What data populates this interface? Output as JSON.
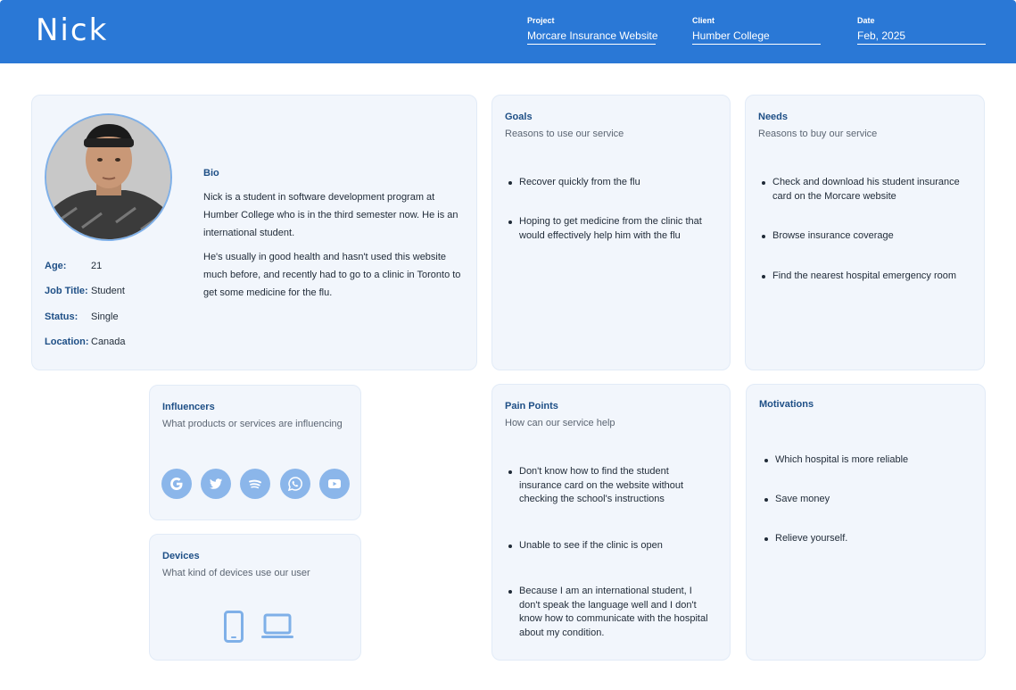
{
  "header": {
    "name": "Nick",
    "project": {
      "label": "Project",
      "value": "Morcare Insurance Website"
    },
    "client": {
      "label": "Client",
      "value": "Humber College"
    },
    "date": {
      "label": "Date",
      "value": "Feb, 2025"
    }
  },
  "profile": {
    "stats": [
      {
        "label": "Age:",
        "value": "21"
      },
      {
        "label": "Job Title:",
        "value": "Student"
      },
      {
        "label": "Status:",
        "value": "Single"
      },
      {
        "label": "Location:",
        "value": "Canada"
      }
    ],
    "bio_label": "Bio",
    "bio": [
      "Nick is a student in software development program at Humber College who is in the third semester now. He is an international student.",
      "He's usually in good health and hasn't used this website much before, and recently had to go to a clinic in Toronto to get some medicine for the flu."
    ]
  },
  "goals": {
    "title": "Goals",
    "subtitle": "Reasons to use our service",
    "items": [
      "Recover quickly from the flu",
      "Hoping to get medicine from the clinic that would effectively help him with the flu"
    ]
  },
  "needs": {
    "title": "Needs",
    "subtitle": "Reasons to buy our service",
    "items": [
      "Check and download his student insurance card on the Morcare website",
      "Browse insurance coverage",
      "Find the nearest hospital emergency room"
    ]
  },
  "influencers": {
    "title": "Influencers",
    "subtitle": "What products or services are influencing",
    "icons": [
      "google-icon",
      "twitter-icon",
      "spotify-icon",
      "whatsapp-icon",
      "youtube-icon"
    ]
  },
  "devices": {
    "title": "Devices",
    "subtitle": "What kind of devices use our user",
    "icons": [
      "phone-icon",
      "laptop-icon"
    ]
  },
  "pain_points": {
    "title": "Pain Points",
    "subtitle": "How can our service help",
    "items": [
      "Don't know how to find the student insurance card on the website without checking the school's instructions",
      "Unable to see if the clinic is open",
      "Because I am an international student, I don't speak the language well and I don't know how to communicate with the hospital about my condition."
    ]
  },
  "motivations": {
    "title": "Motivations",
    "items": [
      "Which hospital is more reliable",
      "Save money",
      "Relieve yourself."
    ]
  },
  "colors": {
    "header": "#2a78d6",
    "card": "#f2f6fc",
    "accent_text": "#1e4f86",
    "icon": "#8bb6ea"
  }
}
